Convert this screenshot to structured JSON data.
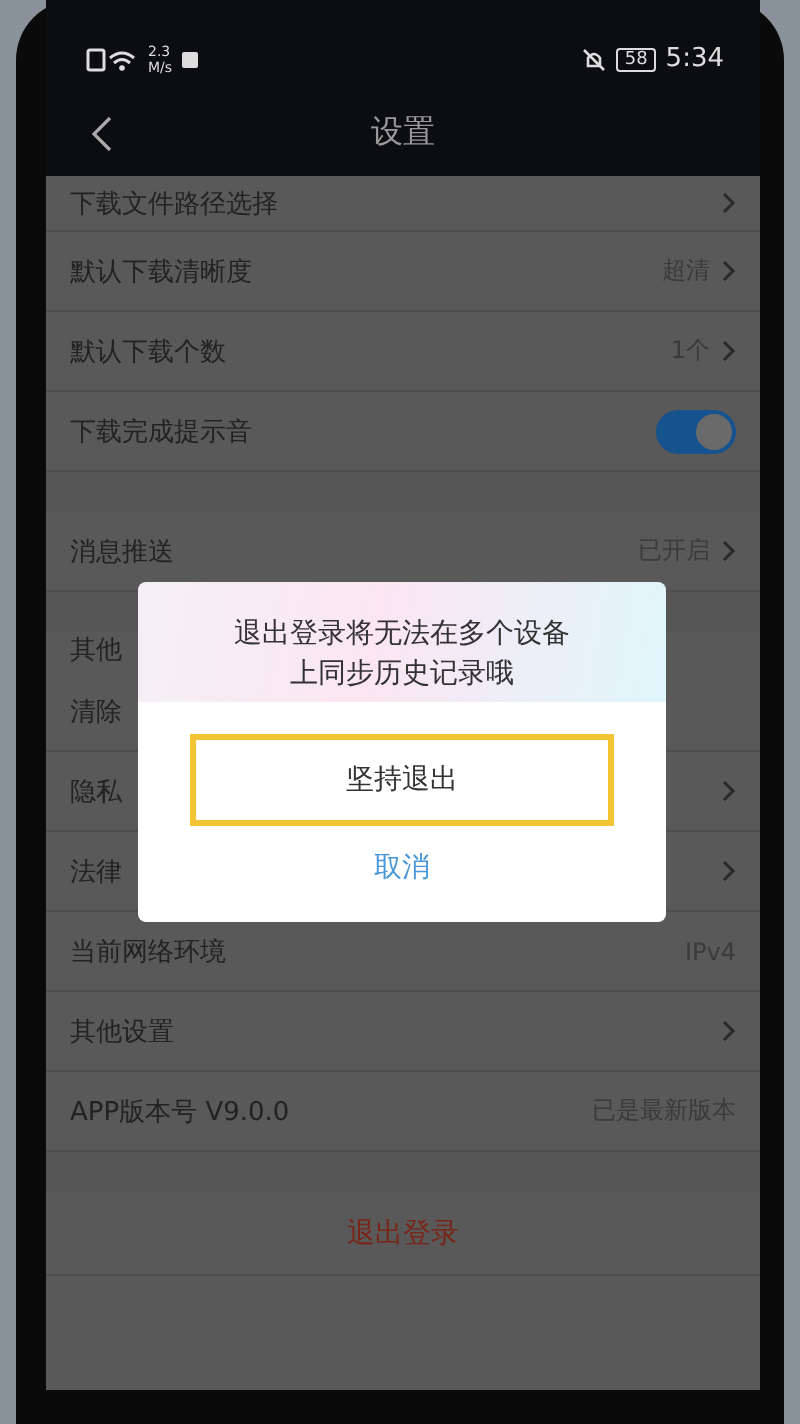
{
  "status_bar": {
    "speed": "2.3",
    "speed_unit": "M/s",
    "battery": "58",
    "time": "5:34"
  },
  "header": {
    "title": "设置"
  },
  "sections": [
    {
      "items": [
        {
          "kind": "link",
          "label": "下载文件路径选择",
          "chevron": true
        },
        {
          "kind": "link",
          "label": "默认下载清晰度",
          "value": "超清",
          "chevron": true
        },
        {
          "kind": "link",
          "label": "默认下载个数",
          "value": "1个",
          "chevron": true
        },
        {
          "kind": "toggle",
          "label": "下载完成提示音",
          "on": true
        }
      ]
    },
    {
      "items": [
        {
          "kind": "link",
          "label": "消息推送",
          "value": "已开启",
          "chevron": true
        }
      ]
    },
    {
      "title": "其他",
      "items": [
        {
          "kind": "link",
          "label": "清除",
          "chevron": false
        },
        {
          "kind": "link",
          "label": "隐私",
          "chevron": true
        },
        {
          "kind": "link",
          "label": "法律",
          "chevron": true
        },
        {
          "kind": "link",
          "label": "当前网络环境",
          "value": "IPv4",
          "chevron": false
        },
        {
          "kind": "link",
          "label": "其他设置",
          "chevron": true
        },
        {
          "kind": "link",
          "label": "APP版本号 V9.0.0",
          "value": "已是最新版本",
          "chevron": false
        }
      ]
    }
  ],
  "logout": "退出登录",
  "dialog": {
    "message": "退出登录将无法在多个设备上同步历史记录哦",
    "confirm": "坚持退出",
    "cancel": "取消"
  }
}
